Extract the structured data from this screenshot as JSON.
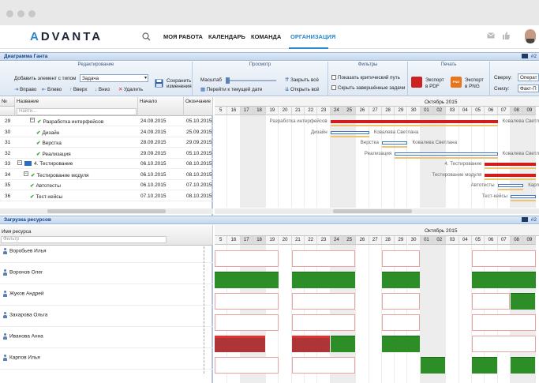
{
  "nav": {
    "items": [
      "МОЯ РАБОТА",
      "КАЛЕНДАРЬ",
      "КОМАНДА",
      "ОРГАНИЗАЦИЯ"
    ],
    "logo_a": "A",
    "logo_b": "DVANTA"
  },
  "gantt": {
    "title": "Диаграмма Ганта",
    "badge": "#2",
    "ribbon": {
      "edit_group": "Редактирование",
      "add_label": "Добавить элемент с типом",
      "add_value": "Задача",
      "save_label": "Сохранить изменения",
      "right": "Вправо",
      "left": "Влево",
      "up": "Вверх",
      "down": "Вниз",
      "delete": "Удалить",
      "view_group": "Просмотр",
      "scale": "Масштаб",
      "collapse_all": "Закрыть всё",
      "expand_all": "Открыть всё",
      "goto_date": "Перейти к текущей дате",
      "filters_group": "Фильтры",
      "critical_path": "Показать критический путь",
      "hide_done": "Скрыть завершённые задачи",
      "print_group": "Печать",
      "export_pdf": "Экспорт в PDF",
      "export_png": "Экспорт в PNG",
      "top_label": "Сверху:",
      "top_value": "Операт",
      "bottom_label": "Снизу:",
      "bottom_value": "Факт-П"
    },
    "columns": {
      "num": "№",
      "name": "Название",
      "start": "Начало",
      "end": "Окончание",
      "filter_placeholder": "Найти..."
    },
    "rows": [
      {
        "num": "29",
        "name": "Разработка интерфейсов",
        "start": "24.09.2015",
        "end": "05.10.2015",
        "indent": 2,
        "type": "summary"
      },
      {
        "num": "30",
        "name": "Дизайн",
        "start": "24.09.2015",
        "end": "25.09.2015",
        "indent": 3,
        "type": "done"
      },
      {
        "num": "31",
        "name": "Верстка",
        "start": "28.09.2015",
        "end": "29.09.2015",
        "indent": 3,
        "type": "done"
      },
      {
        "num": "32",
        "name": "Реализация",
        "start": "29.09.2015",
        "end": "05.10.2015",
        "indent": 3,
        "type": "done"
      },
      {
        "num": "33",
        "name": "4. Тестирование",
        "start": "06.10.2015",
        "end": "08.10.2015",
        "indent": 0,
        "type": "folder"
      },
      {
        "num": "34",
        "name": "Тестирование модуля",
        "start": "06.10.2015",
        "end": "08.10.2015",
        "indent": 1,
        "type": "summary"
      },
      {
        "num": "35",
        "name": "Автотесты",
        "start": "06.10.2015",
        "end": "07.10.2015",
        "indent": 2,
        "type": "done"
      },
      {
        "num": "36",
        "name": "Тест-кейсы",
        "start": "07.10.2015",
        "end": "08.10.2015",
        "indent": 2,
        "type": "done"
      }
    ],
    "month": "Октябрь 2015",
    "days": [
      "5",
      "16",
      "17",
      "18",
      "19",
      "20",
      "21",
      "22",
      "23",
      "24",
      "25",
      "26",
      "27",
      "28",
      "29",
      "30",
      "01",
      "02",
      "03",
      "04",
      "05",
      "06",
      "07",
      "08",
      "09"
    ],
    "bar_labels": [
      {
        "left": "Разработка интерфейсов",
        "right": "Ковалева Светлана"
      },
      {
        "left": "Дизайн",
        "right": "Ковалева Светлана"
      },
      {
        "left": "Верстка",
        "right": "Ковалева Светлана"
      },
      {
        "left": "Реализация",
        "right": "Ковалева Светлана"
      },
      {
        "left": "4. Тестирование",
        "right": ""
      },
      {
        "left": "Тестирование модуля",
        "right": "Ковалева Светлана"
      },
      {
        "left": "Автотесты",
        "right": "Карпов Илья"
      },
      {
        "left": "Тест-кейсы",
        "right": "Карпов Илья"
      }
    ]
  },
  "resources": {
    "title": "Загрузка ресурсов",
    "badge": "#2",
    "col_name": "Имя ресурса",
    "filter_placeholder": "Фильтр",
    "month": "Октябрь 2015",
    "days": [
      "5",
      "16",
      "17",
      "18",
      "19",
      "20",
      "21",
      "22",
      "23",
      "24",
      "25",
      "26",
      "27",
      "28",
      "29",
      "30",
      "01",
      "02",
      "03",
      "04",
      "05",
      "06",
      "07",
      "08",
      "09"
    ],
    "people": [
      "Воробьев Илья",
      "Воронов Олег",
      "Жуков Андрей",
      "Захарова Ольга",
      "Иванова Анна",
      "Карпов Илья"
    ]
  }
}
